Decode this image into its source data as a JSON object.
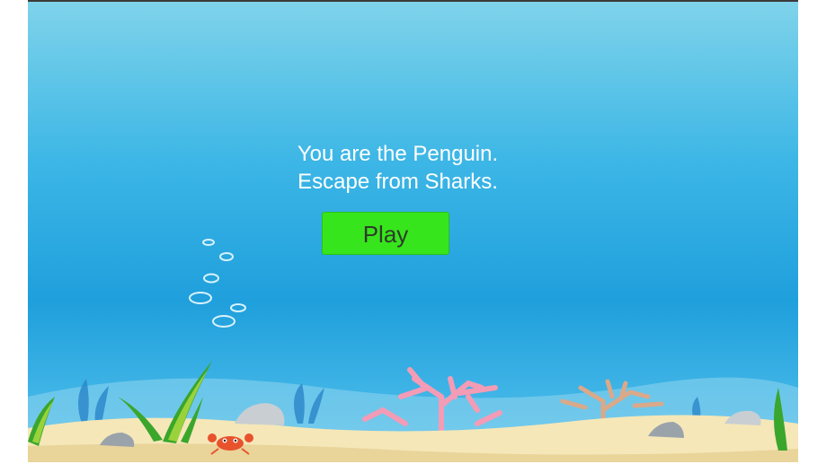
{
  "intro": {
    "line1": "You are the Penguin.",
    "line2": "Escape from Sharks."
  },
  "play_button": {
    "label": "Play"
  },
  "colors": {
    "sky_top": "#7fd3ea",
    "water_mid": "#1f9fdc",
    "button": "#37e51c",
    "sand": "#f5e7b8",
    "seaweed": "#3aa62c",
    "coral_pink": "#f49bb6",
    "coral_tan": "#d9a98a",
    "crab": "#e8532d"
  },
  "scene_icons": [
    "bubbles-icon",
    "seaweed-icon",
    "coral-icon",
    "rock-icon",
    "crab-icon"
  ]
}
